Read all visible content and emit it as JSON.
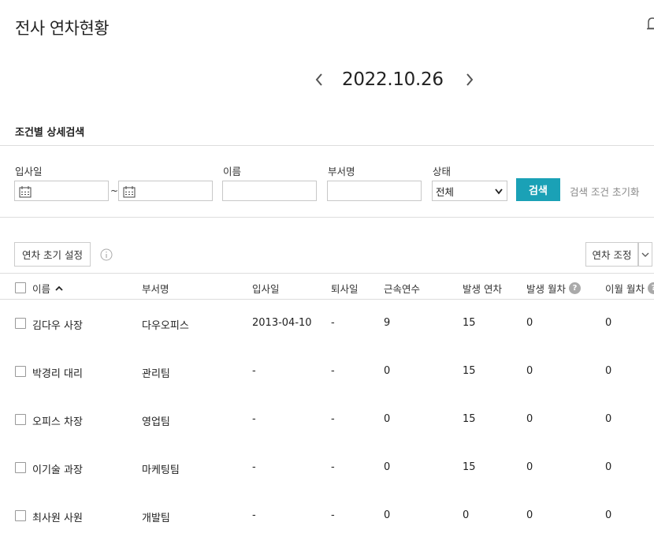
{
  "header": {
    "title": "전사 연차현황"
  },
  "date_nav": {
    "date": "2022.10.26"
  },
  "search": {
    "section_title": "조건별 상세검색",
    "labels": {
      "join_date": "입사일",
      "name": "이름",
      "department": "부서명",
      "status": "상태"
    },
    "join_date_from": "",
    "join_date_to": "",
    "tilde": "~",
    "name_value": "",
    "department_value": "",
    "status_selected": "전체",
    "search_button": "검색",
    "reset_link": "검색 조건 초기화"
  },
  "toolbar": {
    "init_button": "연차 초기 설정",
    "adjust_button": "연차 조정"
  },
  "table": {
    "headers": {
      "name": "이름",
      "department": "부서명",
      "join_date": "입사일",
      "leave_date": "퇴사일",
      "years": "근속연수",
      "annual_generated": "발생 연차",
      "monthly_generated": "발생 월차",
      "monthly_carryover": "이월 월차"
    },
    "rows": [
      {
        "name": "김다우 사장",
        "department": "다우오피스",
        "join_date": "2013-04-10",
        "leave_date": "-",
        "years": "9",
        "annual": "15",
        "monthly": "0",
        "carryover": "0"
      },
      {
        "name": "박경리 대리",
        "department": "관리팀",
        "join_date": "-",
        "leave_date": "-",
        "years": "0",
        "annual": "15",
        "monthly": "0",
        "carryover": "0"
      },
      {
        "name": "오피스 차장",
        "department": "영업팀",
        "join_date": "-",
        "leave_date": "-",
        "years": "0",
        "annual": "15",
        "monthly": "0",
        "carryover": "0"
      },
      {
        "name": "이기술 과장",
        "department": "마케팅팀",
        "join_date": "-",
        "leave_date": "-",
        "years": "0",
        "annual": "15",
        "monthly": "0",
        "carryover": "0"
      },
      {
        "name": "최사원 사원",
        "department": "개발팀",
        "join_date": "-",
        "leave_date": "-",
        "years": "0",
        "annual": "0",
        "monthly": "0",
        "carryover": "0"
      }
    ]
  },
  "colors": {
    "accent": "#1aa1b6",
    "border": "#dddddd",
    "muted_text": "#888888"
  }
}
